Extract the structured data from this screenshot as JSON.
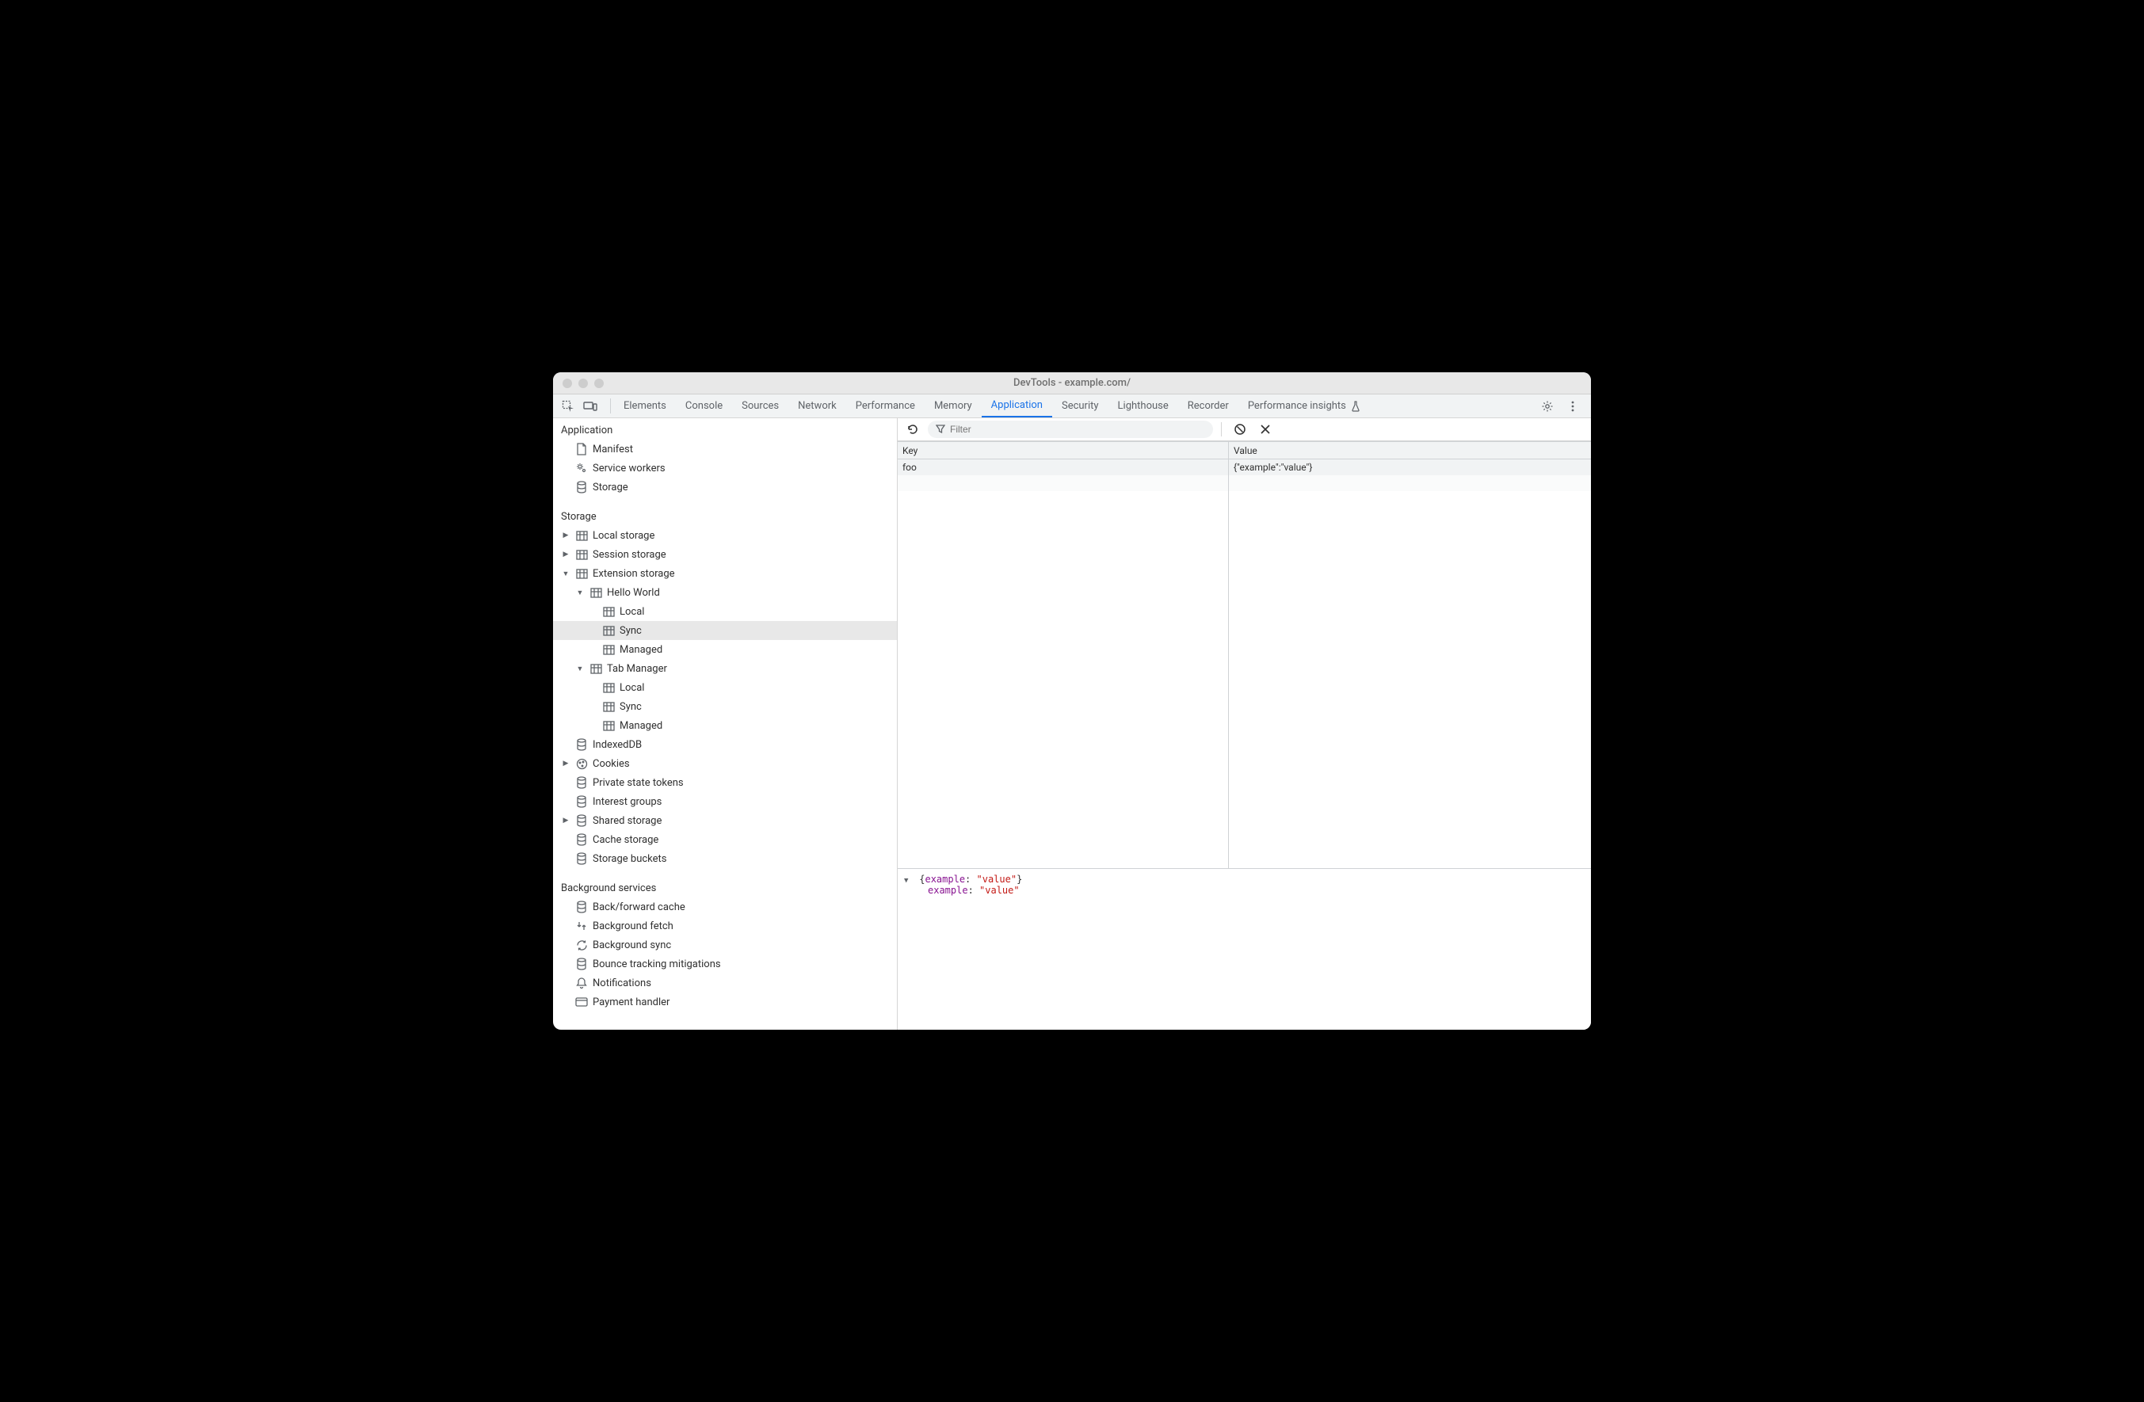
{
  "window": {
    "title": "DevTools - example.com/"
  },
  "tabs": {
    "items": [
      "Elements",
      "Console",
      "Sources",
      "Network",
      "Performance",
      "Memory",
      "Application",
      "Security",
      "Lighthouse",
      "Recorder",
      "Performance insights"
    ],
    "active": "Application",
    "experiment_tab": "Performance insights"
  },
  "sidebar": {
    "sections": {
      "application": {
        "title": "Application",
        "items": [
          "Manifest",
          "Service workers",
          "Storage"
        ]
      },
      "storage": {
        "title": "Storage",
        "local_storage": "Local storage",
        "session_storage": "Session storage",
        "extension_storage": "Extension storage",
        "ext_hello": "Hello World",
        "ext_hello_local": "Local",
        "ext_hello_sync": "Sync",
        "ext_hello_managed": "Managed",
        "ext_tabmgr": "Tab Manager",
        "ext_tabmgr_local": "Local",
        "ext_tabmgr_sync": "Sync",
        "ext_tabmgr_managed": "Managed",
        "indexeddb": "IndexedDB",
        "cookies": "Cookies",
        "private_state_tokens": "Private state tokens",
        "interest_groups": "Interest groups",
        "shared_storage": "Shared storage",
        "cache_storage": "Cache storage",
        "storage_buckets": "Storage buckets"
      },
      "background": {
        "title": "Background services",
        "items": [
          "Back/forward cache",
          "Background fetch",
          "Background sync",
          "Bounce tracking mitigations",
          "Notifications",
          "Payment handler"
        ]
      }
    }
  },
  "toolbar": {
    "filter_placeholder": "Filter"
  },
  "table": {
    "headers": {
      "key": "Key",
      "value": "Value"
    },
    "rows": [
      {
        "key": "foo",
        "value": "{\"example\":\"value\"}"
      }
    ]
  },
  "detail": {
    "summary_open": "{",
    "summary_key": "example",
    "summary_sep": ": ",
    "summary_val": "\"value\"",
    "summary_close": "}",
    "prop_key": "example",
    "prop_sep": ": ",
    "prop_val": "\"value\""
  }
}
